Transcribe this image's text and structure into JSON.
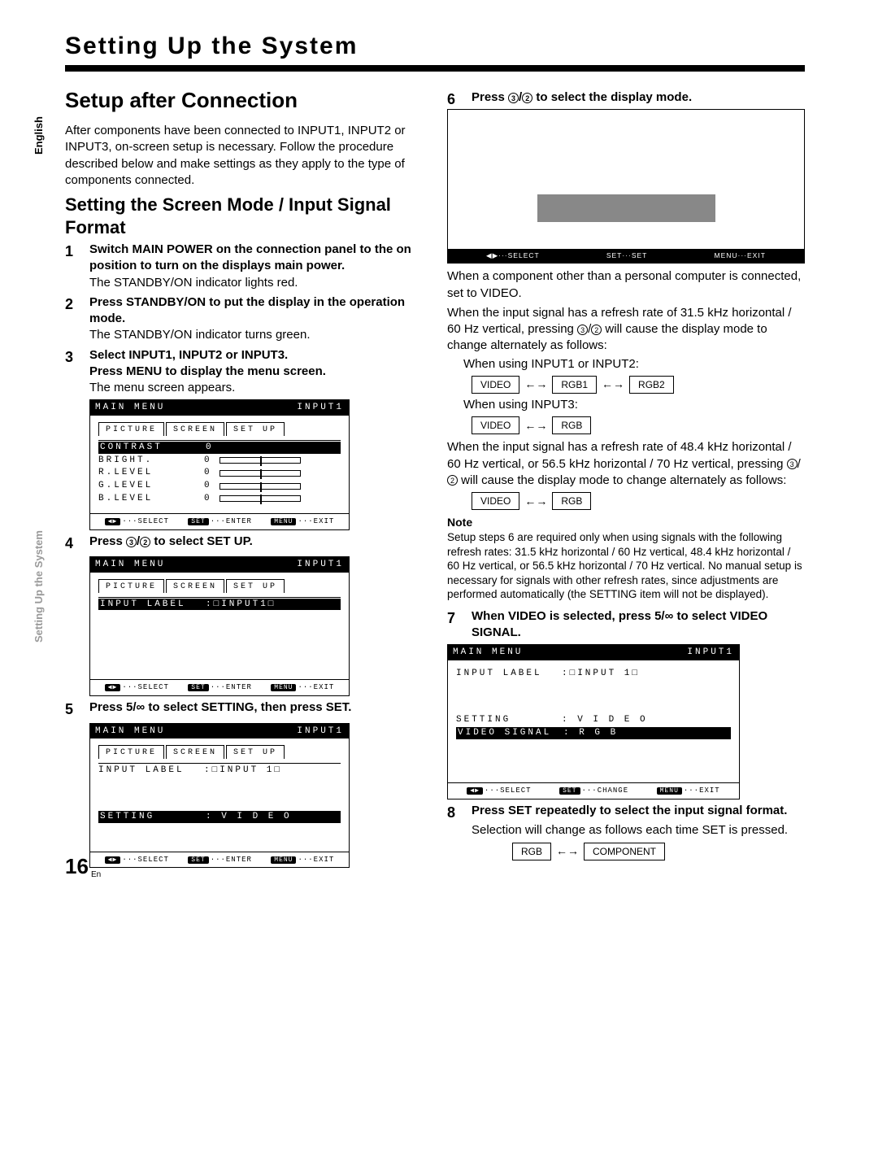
{
  "side": {
    "lang": "English",
    "section": "Setting Up the System"
  },
  "chapter": "Setting Up the System",
  "left": {
    "h2": "Setup after Connection",
    "intro": "After components have been connected to INPUT1, INPUT2 or INPUT3, on-screen setup is necessary. Follow the procedure described below and make settings as they apply to the type of components connected.",
    "h3": "Setting the Screen Mode / Input Signal Format",
    "step1": "Switch MAIN POWER on the connection panel to the on position to turn on the displays main power.",
    "step1_sub": "The STANDBY/ON indicator lights red.",
    "step2": "Press STANDBY/ON to put the display in the operation mode.",
    "step2_sub": "The STANDBY/ON indicator turns green.",
    "step3a": "Select INPUT1, INPUT2 or INPUT3.",
    "step3b": "Press MENU to display the menu screen.",
    "step3_sub": "The menu screen appears.",
    "menu1": {
      "title_l": "MAIN MENU",
      "title_r": "INPUT1",
      "tabs": [
        "PICTURE",
        "SCREEN",
        "SET UP"
      ],
      "rows": [
        {
          "label": "CONTRAST",
          "val": "0",
          "hl": true,
          "bar": true
        },
        {
          "label": "BRIGHT.",
          "val": "0",
          "bar": true
        },
        {
          "label": "R.LEVEL",
          "val": "0",
          "bar": true
        },
        {
          "label": "G.LEVEL",
          "val": "0",
          "bar": true
        },
        {
          "label": "B.LEVEL",
          "val": "0",
          "bar": true
        }
      ],
      "foot": [
        "SELECT",
        "ENTER",
        "EXIT"
      ],
      "foot_btn": [
        "",
        "SET",
        "MENU"
      ]
    },
    "step4": "Press 3/2 to select SET UP.",
    "menu2": {
      "title_l": "MAIN MENU",
      "title_r": "INPUT1",
      "tabs": [
        "PICTURE",
        "SCREEN",
        "SET UP"
      ],
      "rows": [
        {
          "label": "INPUT LABEL",
          "val": ":□INPUT1□",
          "hl": true
        }
      ],
      "foot": [
        "SELECT",
        "ENTER",
        "EXIT"
      ]
    },
    "step5_pre": "Press 5/∞ to select SETTING, then press SET.",
    "menu3": {
      "title_l": "MAIN MENU",
      "title_r": "INPUT1",
      "tabs": [
        "PICTURE",
        "SCREEN",
        "SET UP"
      ],
      "rows": [
        {
          "label": "INPUT LABEL",
          "val": ":□INPUT 1□"
        },
        {
          "label": "",
          "val": ""
        },
        {
          "label": "",
          "val": ""
        },
        {
          "label": "SETTING",
          "val": ": V I D E O",
          "hl": true
        }
      ],
      "foot": [
        "SELECT",
        "ENTER",
        "EXIT"
      ]
    }
  },
  "right": {
    "step6": "Press 3/2 to select the display mode.",
    "display_foot": [
      "SELECT",
      "SET",
      "EXIT"
    ],
    "display_foot_btn": [
      "",
      "SET",
      "MENU"
    ],
    "p1": "When a component other than a personal computer is connected, set to VIDEO.",
    "p2": "When the input signal has a refresh rate of 31.5 kHz horizontal / 60 Hz vertical, pressing 3/2 will cause the display mode to change alternately as follows:",
    "flow1_label": "When using INPUT1 or INPUT2:",
    "flow1": [
      "VIDEO",
      "RGB1",
      "RGB2"
    ],
    "flow2_label": "When using INPUT3:",
    "flow2": [
      "VIDEO",
      "RGB"
    ],
    "p3": "When the input signal has a refresh rate of 48.4 kHz horizontal / 60 Hz vertical, or 56.5 kHz horizontal / 70 Hz vertical, pressing 3/2 will cause the display mode to change alternately as follows:",
    "flow3": [
      "VIDEO",
      "RGB"
    ],
    "note_head": "Note",
    "note": "Setup steps 6 are required only when using signals with the following refresh rates: 31.5 kHz horizontal / 60 Hz vertical, 48.4 kHz horizontal / 60 Hz vertical, or 56.5 kHz horizontal / 70 Hz vertical. No manual setup is necessary for signals with other refresh rates, since adjustments are performed automatically (the SETTING item will not be displayed).",
    "step7": "When VIDEO is selected, press 5/∞ to select VIDEO SIGNAL.",
    "menu4": {
      "title_l": "MAIN MENU",
      "title_r": "INPUT1",
      "rows": [
        {
          "label": "INPUT LABEL",
          "val": ":□INPUT 1□"
        },
        {
          "label": "",
          "val": ""
        },
        {
          "label": "",
          "val": ""
        },
        {
          "label": "SETTING",
          "val": ":   V I D E O"
        },
        {
          "label": "VIDEO SIGNAL",
          "val": ":   R G B",
          "hl": true
        }
      ],
      "foot": [
        "SELECT",
        "CHANGE",
        "EXIT"
      ]
    },
    "step8": "Press SET repeatedly to select the input signal format.",
    "step8_sub": "Selection will change as follows each time SET is pressed.",
    "flow4": [
      "RGB",
      "COMPONENT"
    ]
  },
  "pagenum": "16",
  "pagelang": "En"
}
